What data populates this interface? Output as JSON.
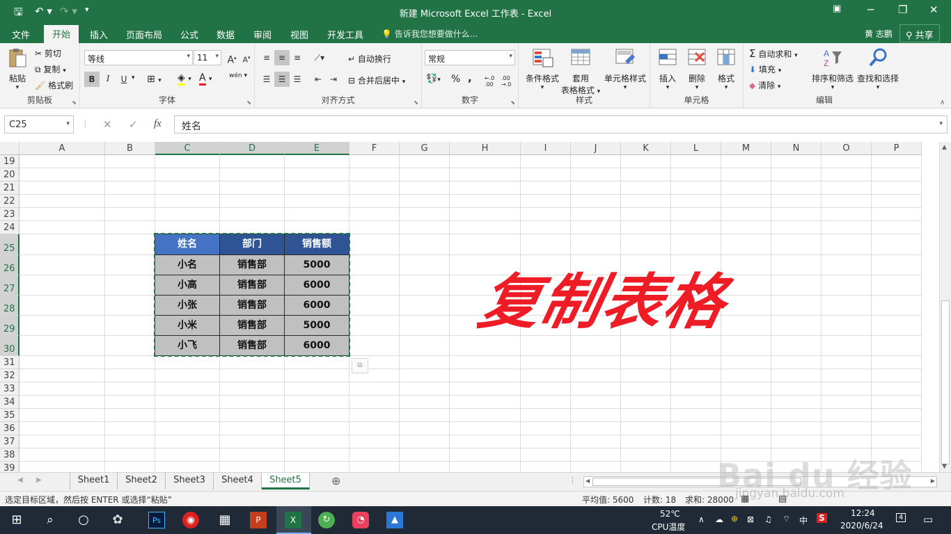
{
  "window": {
    "title": "新建 Microsoft Excel 工作表 - Excel"
  },
  "menu": {
    "tabs": [
      "文件",
      "开始",
      "插入",
      "页面布局",
      "公式",
      "数据",
      "审阅",
      "视图",
      "开发工具"
    ],
    "active": "开始",
    "tell_me": "告诉我您想要做什么...",
    "user": "黄 志鹏",
    "share": "共享"
  },
  "ribbon": {
    "clipboard": {
      "paste": "粘贴",
      "cut": "剪切",
      "copy": "复制",
      "format_painter": "格式刷",
      "label": "剪贴板"
    },
    "font": {
      "name": "等线",
      "size": "11",
      "bold": "B",
      "italic": "I",
      "underline": "U",
      "grow": "A",
      "shrink": "A",
      "phonetic": "wén",
      "label": "字体"
    },
    "alignment": {
      "wrap": "自动换行",
      "merge": "合并后居中",
      "label": "对齐方式"
    },
    "number": {
      "format": "常规",
      "percent": "%",
      "comma": ",",
      "inc": "←.0 .00",
      "dec": ".00 →.0",
      "label": "数字"
    },
    "styles": {
      "conditional": "条件格式",
      "table1": "套用",
      "table2": "表格格式",
      "cell_styles": "单元格样式",
      "label": "样式"
    },
    "cells": {
      "insert": "插入",
      "delete": "删除",
      "format": "格式",
      "label": "单元格"
    },
    "editing": {
      "autosum": "自动求和",
      "fill": "填充",
      "clear": "清除",
      "sort": "排序和筛选",
      "find": "查找和选择",
      "label": "编辑"
    }
  },
  "formula_bar": {
    "name_box": "C25",
    "content": "姓名",
    "fx": "fx"
  },
  "columns": [
    "A",
    "B",
    "C",
    "D",
    "E",
    "F",
    "G",
    "H",
    "I",
    "J",
    "K",
    "L",
    "M",
    "N",
    "O",
    "P"
  ],
  "selected_columns": [
    "C",
    "D",
    "E"
  ],
  "rows": [
    "19",
    "20",
    "21",
    "22",
    "23",
    "24",
    "25",
    "26",
    "27",
    "28",
    "29",
    "30",
    "31",
    "32",
    "33",
    "34",
    "35",
    "36",
    "37",
    "38",
    "39"
  ],
  "selected_rows": [
    "25",
    "26",
    "27",
    "28",
    "29",
    "30"
  ],
  "table": {
    "headers": [
      "姓名",
      "部门",
      "销售额"
    ],
    "rows": [
      [
        "小名",
        "销售部",
        "5000"
      ],
      [
        "小高",
        "销售部",
        "6000"
      ],
      [
        "小张",
        "销售部",
        "6000"
      ],
      [
        "小米",
        "销售部",
        "5000"
      ],
      [
        "小飞",
        "销售部",
        "6000"
      ]
    ]
  },
  "overlay_text": "复制表格",
  "sheets": {
    "tabs": [
      "Sheet1",
      "Sheet2",
      "Sheet3",
      "Sheet4",
      "Sheet5"
    ],
    "active": "Sheet5"
  },
  "status": {
    "message": "选定目标区域，然后按 ENTER 或选择“粘贴”",
    "average": "平均值: 5600",
    "count": "计数: 18",
    "sum": "求和: 28000"
  },
  "taskbar": {
    "temp": "52℃",
    "temp_label": "CPU温度",
    "ime": "中",
    "time": "12:24",
    "date": "2020/6/24",
    "notif": "4"
  },
  "watermark": {
    "logo": "Bai du 经验",
    "url": "jingyan.baidu.com"
  },
  "colors": {
    "excel_green": "#217346",
    "header_blue": "#2f5496",
    "header_blue_light": "#4472c4",
    "data_gray": "#c0c0c0",
    "title_red": "#ee1c25"
  }
}
